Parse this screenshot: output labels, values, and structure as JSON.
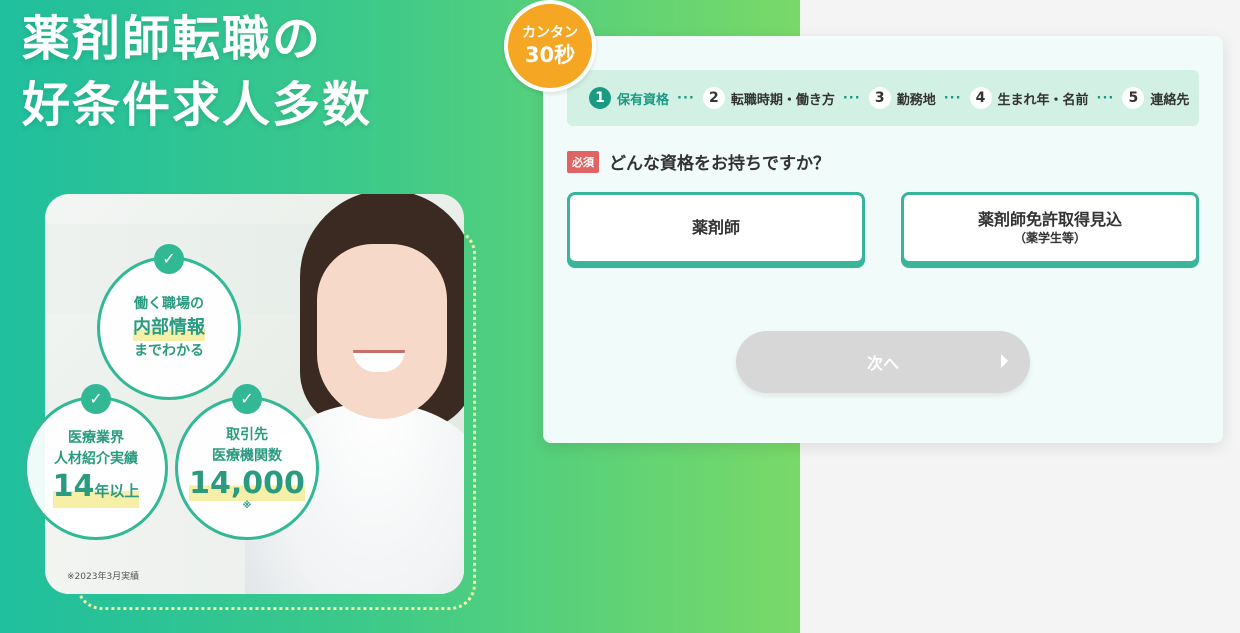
{
  "hero": {
    "title_line1": "薬剤師転職の",
    "title_line2": "好条件求人多数"
  },
  "badges": {
    "one": {
      "line1": "働く職場の",
      "highlight": "内部情報",
      "line3": "までわかる"
    },
    "two": {
      "line1": "医療業界",
      "line2": "人材紹介実績",
      "big": "14",
      "small": "年以上"
    },
    "three": {
      "line1": "取引先",
      "line2": "医療機関数",
      "big": "14,000",
      "note": "※"
    }
  },
  "footnote": "※2023年3月実績",
  "timer": {
    "line1": "カンタン",
    "line2": "30秒"
  },
  "steps": [
    {
      "num": "1",
      "label": "保有資格"
    },
    {
      "num": "2",
      "label": "転職時期・働き方"
    },
    {
      "num": "3",
      "label": "勤務地"
    },
    {
      "num": "4",
      "label": "生まれ年・名前"
    },
    {
      "num": "5",
      "label": "連絡先"
    }
  ],
  "step_separator": "···",
  "question": {
    "required": "必須",
    "text": "どんな資格をお持ちですか？"
  },
  "options": [
    {
      "label": "薬剤師",
      "sub": ""
    },
    {
      "label": "薬剤師免許取得見込",
      "sub": "（薬学生等）"
    }
  ],
  "next_button": "次へ",
  "colors": {
    "primary": "#1a9a83",
    "accent": "#f5a623",
    "required": "#e06464",
    "disabled": "#d7d7d7"
  }
}
